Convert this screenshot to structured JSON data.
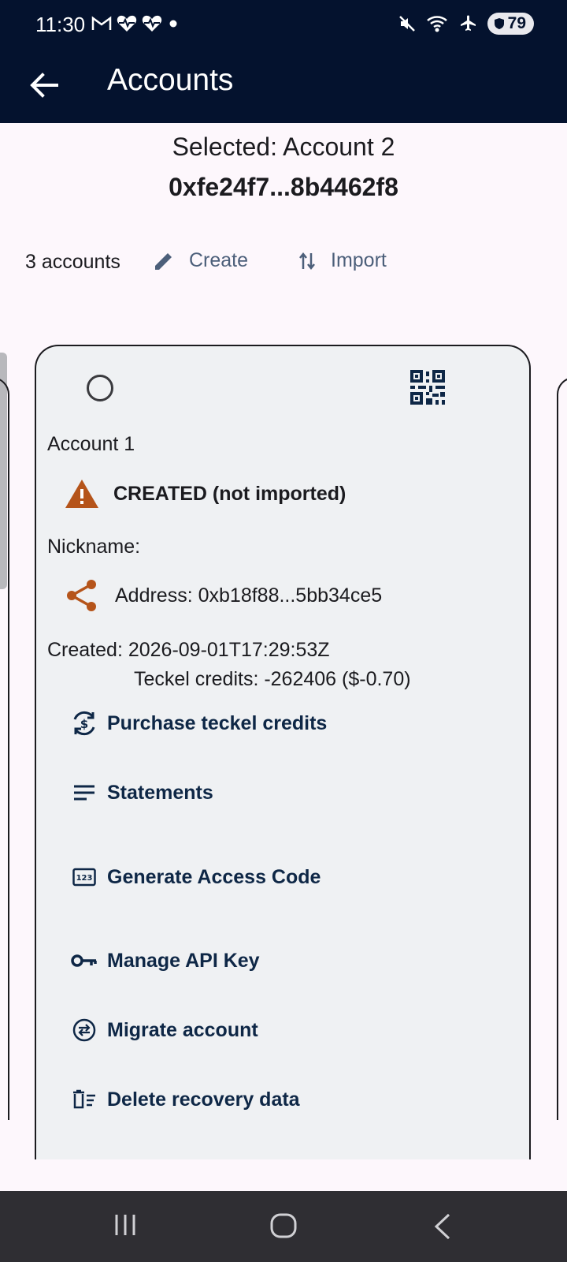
{
  "status_bar": {
    "time": "11:30",
    "battery": "79"
  },
  "app_bar": {
    "title": "Accounts"
  },
  "selection": {
    "label": "Selected: Account 2",
    "address": "0xfe24f7...8b4462f8"
  },
  "toolbar": {
    "count": "3 accounts",
    "create_label": "Create",
    "import_label": "Import"
  },
  "account_card": {
    "name": "Account 1",
    "status": "CREATED (not imported)",
    "nickname": "Nickname:",
    "address": "Address: 0xb18f88...5bb34ce5",
    "created": "Created: 2026-09-01T17:29:53Z",
    "credits": "Teckel credits: -262406 ($-0.70)",
    "actions": [
      {
        "label": "Purchase teckel credits",
        "icon": "currency-exchange-icon"
      },
      {
        "label": "Statements",
        "icon": "list-icon"
      },
      {
        "label": "Generate Access Code",
        "icon": "pin-123-icon"
      },
      {
        "label": "Manage API Key",
        "icon": "key-icon"
      },
      {
        "label": "Migrate account",
        "icon": "swap-circle-icon"
      },
      {
        "label": "Delete recovery data",
        "icon": "delete-sweep-icon"
      }
    ]
  },
  "colors": {
    "header_bg": "#04122e",
    "accent_orange": "#b5541a",
    "action_text": "#0e2746",
    "toolbar_button": "#4c5f7a"
  }
}
